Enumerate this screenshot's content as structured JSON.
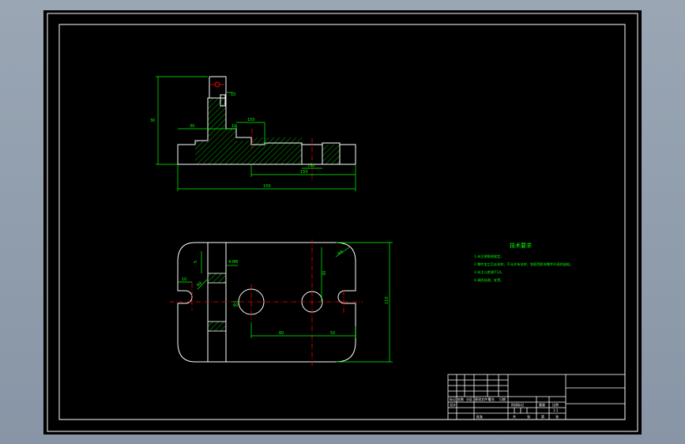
{
  "app": {
    "background": "#9aa6b4",
    "canvas_color": "#000000"
  },
  "colors": {
    "frame": "#ffffff",
    "outline": "#ffffff",
    "dimension": "#00ff00",
    "centerline": "#ff0000",
    "hatch": "#00ff00",
    "note_text": "#00ff00"
  },
  "front_view": {
    "dims": {
      "overall_height": "30",
      "hole_offset": "10",
      "step_left": "30",
      "step_mid": "10",
      "slot_width": "150",
      "right_step": "150",
      "pocket_width": "150",
      "overall_length": "150"
    }
  },
  "top_view": {
    "dims": {
      "radius": "R8",
      "corner_radius": "R8",
      "small_a": "10",
      "small_b": "5",
      "small_c": "60",
      "center_height": "30",
      "rib_label": "4-M6",
      "width_left": "60",
      "width_right": "50",
      "overall_height": "110"
    }
  },
  "technical_requirements": {
    "title": "技术要求",
    "lines": [
      "1.未注倒角按规定。",
      "2.零件加工后去毛刺，不允许有毛刺、划痕等影响零件外观的缺陷。",
      "3.未注公差按IT14。",
      "4.调质处理，发黑。"
    ]
  },
  "title_block": {
    "row_labels": [
      "标记",
      "处数",
      "分区",
      "更改文件号",
      "签名",
      "日期"
    ],
    "designer": "设计",
    "stage_label": "阶段标记",
    "weight_label": "重量",
    "scale_label": "比例",
    "scale_value": "1:1",
    "sheet_labels": [
      "共",
      "张",
      "第",
      "张"
    ],
    "approve": "批准"
  }
}
